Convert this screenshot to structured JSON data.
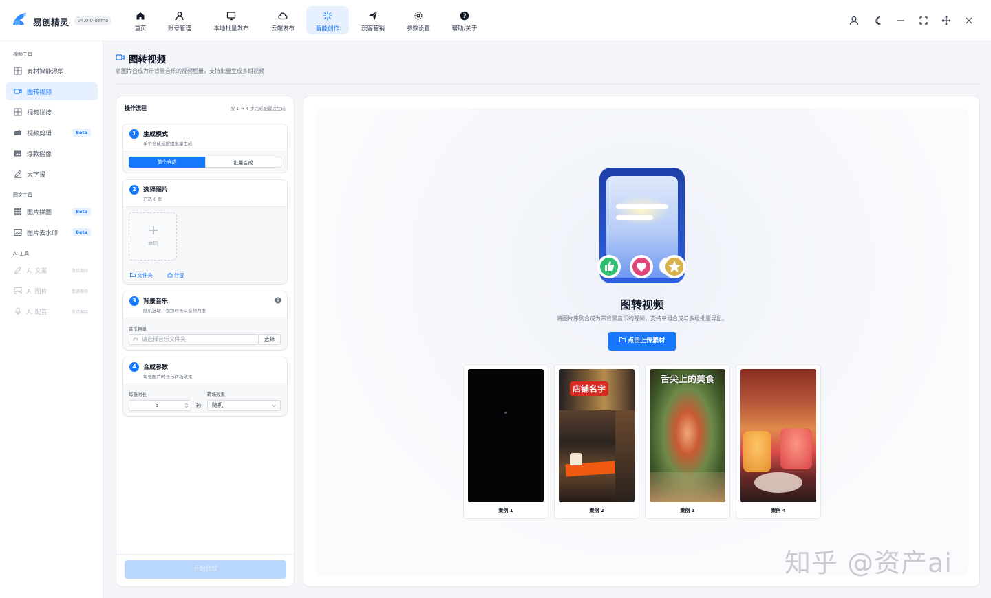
{
  "app": {
    "brand": "易创精灵",
    "version": "v4.0.0-demo"
  },
  "nav": [
    {
      "label": "首页",
      "icon": "home-icon"
    },
    {
      "label": "账号管理",
      "icon": "user-icon"
    },
    {
      "label": "本地批量发布",
      "icon": "monitor-icon"
    },
    {
      "label": "云端发布",
      "icon": "cloud-icon"
    },
    {
      "label": "智能创作",
      "icon": "sparkle-icon",
      "active": true
    },
    {
      "label": "获客营销",
      "icon": "send-icon"
    },
    {
      "label": "参数设置",
      "icon": "gear-icon"
    },
    {
      "label": "帮助/关于",
      "icon": "help-icon"
    }
  ],
  "window_controls": [
    "user-icon",
    "moon-icon",
    "minimize-icon",
    "fullscreen-icon",
    "move-icon",
    "close-icon"
  ],
  "sidebar": {
    "sections": [
      {
        "title": "视频工具",
        "items": [
          {
            "label": "素材智能混剪",
            "icon": "grid-icon"
          },
          {
            "label": "图转视频",
            "icon": "video-icon",
            "active": true
          },
          {
            "label": "视频拼接",
            "icon": "grid-icon"
          },
          {
            "label": "视频剪辑",
            "icon": "film-icon",
            "badge": "Beta"
          },
          {
            "label": "爆款摇像",
            "icon": "image-icon"
          },
          {
            "label": "大字报",
            "icon": "pen-icon"
          }
        ]
      },
      {
        "title": "图文工具",
        "items": [
          {
            "label": "图片拼图",
            "icon": "grid-icon",
            "badge": "Beta"
          },
          {
            "label": "图片去水印",
            "icon": "image-icon",
            "badge": "Beta"
          }
        ]
      },
      {
        "title": "AI 工具",
        "items": [
          {
            "label": "AI 文案",
            "icon": "pen-icon",
            "note": "敬请期待",
            "disabled": true
          },
          {
            "label": "AI 图片",
            "icon": "image-icon",
            "note": "敬请期待",
            "disabled": true
          },
          {
            "label": "AI 配音",
            "icon": "mic-icon",
            "note": "敬请期待",
            "disabled": true
          }
        ]
      }
    ]
  },
  "page": {
    "title": "图转视频",
    "desc": "将图片合成为带背景音乐的视频相册，支持批量生成多组视频"
  },
  "flow": {
    "title": "操作流程",
    "hint": "按 1 → 4 步完成配置后生成",
    "step1": {
      "num": "1",
      "title": "生成模式",
      "sub": "单个合成或按组批量生成",
      "seg_single": "单个合成",
      "seg_batch": "批量合成"
    },
    "step2": {
      "num": "2",
      "title": "选择图片",
      "sub": "已选 0 张",
      "add_label": "添加",
      "link_folder": "文件夹",
      "link_works": "作品"
    },
    "step3": {
      "num": "3",
      "title": "背景音乐",
      "sub": "随机选取，视频时长以音频为准",
      "dir_label": "音乐目录",
      "dir_placeholder": "请选择音乐文件夹",
      "choose": "选择"
    },
    "step4": {
      "num": "4",
      "title": "合成参数",
      "sub": "每张图片时长与转场效果",
      "dur_label": "每张时长",
      "dur_value": "3",
      "dur_unit": "秒",
      "trans_label": "转场效果",
      "trans_value": "随机"
    },
    "start": "开始合成"
  },
  "preview": {
    "title": "图转视频",
    "desc": "将图片序列合成为带背景音乐的视频，支持单组合成与多组批量导出。",
    "upload": "点击上传素材",
    "cases": [
      {
        "label": "案例 1"
      },
      {
        "label": "案例 2",
        "overlay": "店铺名字"
      },
      {
        "label": "案例 3",
        "overlay": "舌尖上的美食"
      },
      {
        "label": "案例 4"
      }
    ]
  },
  "watermark": "知乎 @资产ai"
}
